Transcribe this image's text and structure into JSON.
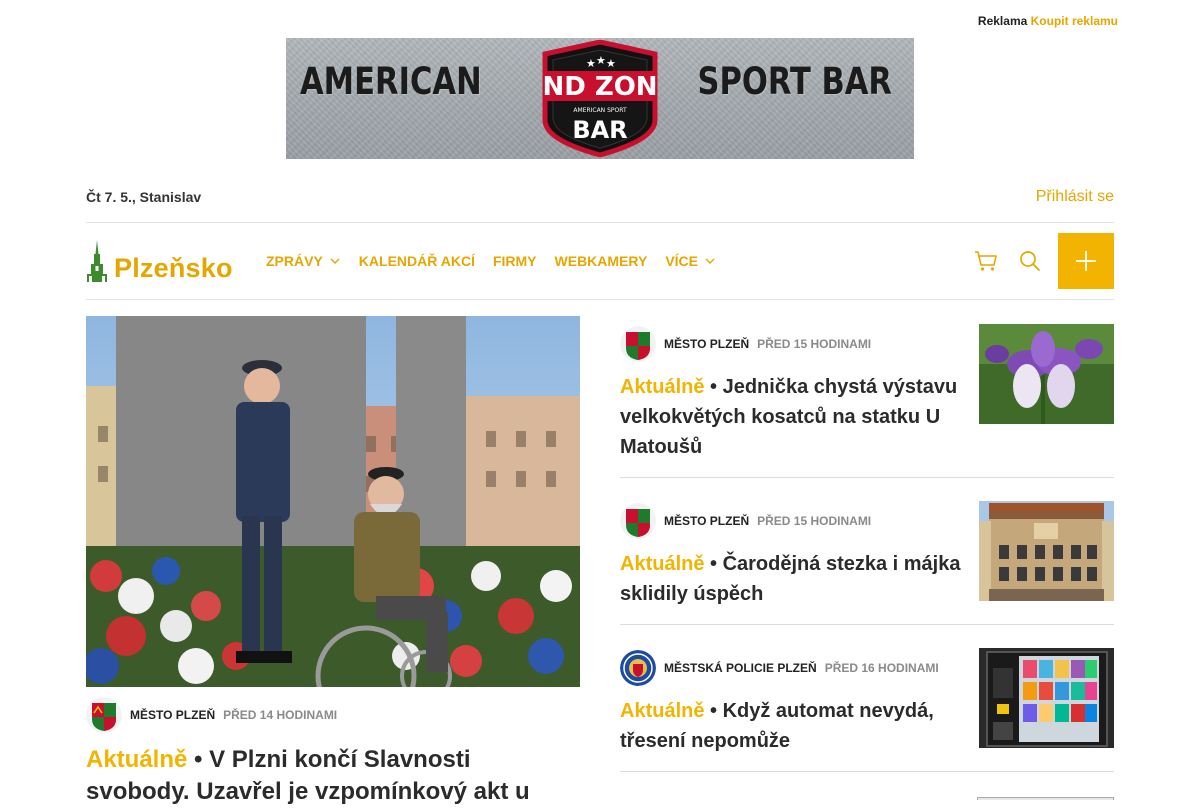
{
  "ads": {
    "reklama_label": "Reklama",
    "buy_label": "Koupit reklamu"
  },
  "banner": {
    "left_word": "AMERICAN",
    "right_word": "SPORT BAR",
    "badge_top": "END ZONE",
    "badge_small": "AMERICAN SPORT",
    "badge_bottom": "BAR"
  },
  "header": {
    "date": "Čt 7. 5., Stanislav",
    "login_label": "Přihlásit se"
  },
  "logo": {
    "text": "Plzeňsko"
  },
  "nav": {
    "items": [
      {
        "label": "ZPRÁVY",
        "has_dropdown": true
      },
      {
        "label": "KALENDÁŘ AKCÍ",
        "has_dropdown": false
      },
      {
        "label": "FIRMY",
        "has_dropdown": false
      },
      {
        "label": "WEBKAMERY",
        "has_dropdown": false
      },
      {
        "label": "VÍCE",
        "has_dropdown": true
      }
    ],
    "icons": [
      "cart-icon",
      "search-icon",
      "plus-icon"
    ]
  },
  "colors": {
    "accent": "#f2b400",
    "text": "#2b2b2b",
    "muted": "#8a8a8a"
  },
  "main_article": {
    "source": "MĚSTO PLZEŇ",
    "time": "PŘED 14 HODINAMI",
    "kicker": "Aktuálně",
    "title": " • V Plzni končí Slavnosti svobody. Uzavřel je vzpomínkový akt u"
  },
  "side_articles": [
    {
      "source": "MĚSTO PLZEŇ",
      "time": "PŘED 15 HODINAMI",
      "kicker": "Aktuálně",
      "title": " • Jednička chystá výstavu velkokvětých kosatců na statku U Matoušů"
    },
    {
      "source": "MĚSTO PLZEŇ",
      "time": "PŘED 15 HODINAMI",
      "kicker": "Aktuálně",
      "title": " • Čarodějná stezka i májka sklidily úspěch"
    },
    {
      "source": "MĚSTSKÁ POLICIE PLZEŇ",
      "time": "PŘED 16 HODINAMI",
      "kicker": "Aktuálně",
      "title": " • Když automat nevydá, třesení nepomůže"
    }
  ]
}
